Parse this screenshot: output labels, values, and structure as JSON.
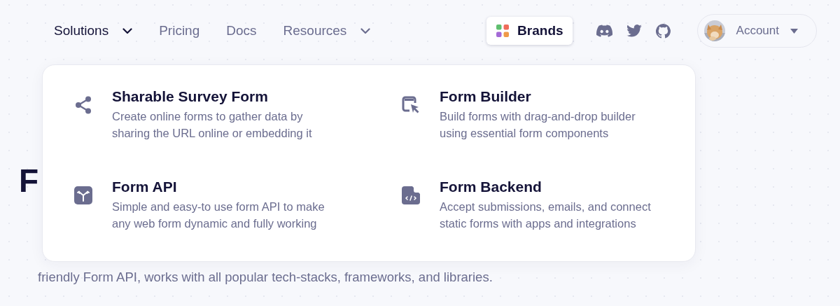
{
  "nav": {
    "items": [
      {
        "label": "Solutions",
        "kind": "dropdown",
        "selected": true
      },
      {
        "label": "Pricing",
        "kind": "link",
        "selected": false
      },
      {
        "label": "Docs",
        "kind": "link",
        "selected": false
      },
      {
        "label": "Resources",
        "kind": "dropdown",
        "selected": false
      }
    ],
    "brands_button": "Brands",
    "account": {
      "label": "Account"
    }
  },
  "solutions_menu": {
    "items": [
      {
        "title": "Sharable Survey Form",
        "description": "Create online forms to gather data by sharing the URL online or embedding it"
      },
      {
        "title": "Form Builder",
        "description": "Build forms with drag-and-drop builder using essential form components"
      },
      {
        "title": "Form API",
        "description": "Simple and easy-to use form API to make any web form dynamic and fully working"
      },
      {
        "title": "Form Backend",
        "description": "Accept submissions, emails, and connect static forms with apps and integrations"
      }
    ]
  },
  "hero": {
    "heading": "F",
    "paragraph_lines": [
      "friendly Form API, works with all popular tech-stacks, frameworks, and libraries."
    ]
  }
}
